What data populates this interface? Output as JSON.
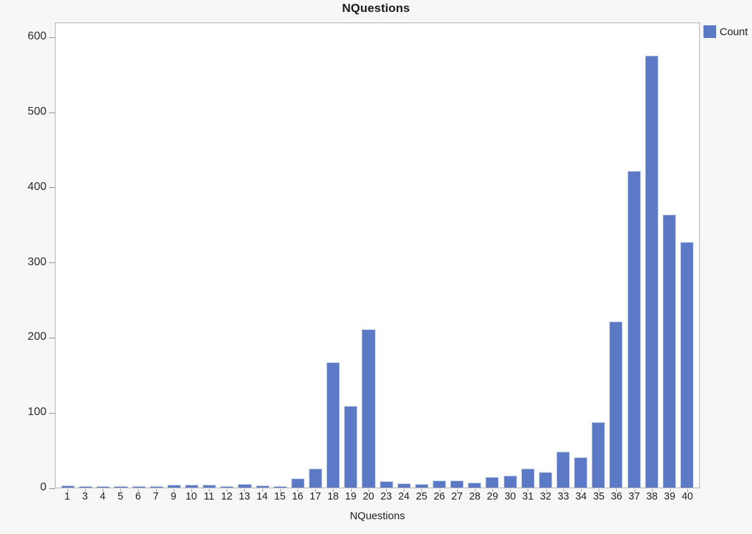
{
  "chart_data": {
    "type": "bar",
    "title": "NQuestions",
    "xlabel": "NQuestions",
    "ylabel": "",
    "ylim": [
      0,
      620
    ],
    "yticks": [
      0,
      100,
      200,
      300,
      400,
      500,
      600
    ],
    "grid": false,
    "legend_position": "right",
    "series_name": "Count",
    "bar_color": "#5b79c4",
    "categories": [
      "1",
      "3",
      "4",
      "5",
      "6",
      "7",
      "9",
      "10",
      "11",
      "12",
      "13",
      "14",
      "15",
      "16",
      "17",
      "18",
      "19",
      "20",
      "23",
      "24",
      "25",
      "26",
      "27",
      "28",
      "29",
      "30",
      "31",
      "32",
      "33",
      "34",
      "35",
      "36",
      "37",
      "38",
      "39",
      "40"
    ],
    "values": [
      3,
      2,
      1,
      2,
      2,
      1,
      4,
      4,
      4,
      1,
      5,
      3,
      2,
      12,
      25,
      167,
      109,
      211,
      8,
      6,
      5,
      9,
      9,
      7,
      14,
      16,
      25,
      21,
      48,
      40,
      87,
      221,
      421,
      575,
      363,
      327
    ]
  },
  "legend": {
    "items": [
      {
        "label": "Count",
        "color": "#5b79c4"
      }
    ]
  }
}
